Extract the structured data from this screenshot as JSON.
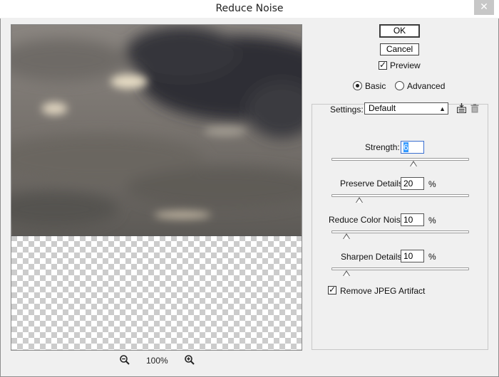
{
  "window": {
    "title": "Reduce Noise",
    "close_glyph": "✕"
  },
  "preview": {
    "zoom_level": "100%",
    "zoom_out_icon": "zoom-out-icon",
    "zoom_in_icon": "zoom-in-icon"
  },
  "buttons": {
    "ok": "OK",
    "cancel": "Cancel"
  },
  "preview_checkbox": {
    "label": "Preview",
    "checked": true
  },
  "mode": {
    "basic": "Basic",
    "advanced": "Advanced",
    "selected": "Basic"
  },
  "settings": {
    "label": "Settings:",
    "value": "Default",
    "save_icon": "save-preset-icon",
    "delete_icon": "trash-icon"
  },
  "sliders": {
    "strength": {
      "label": "Strength:",
      "value": "6",
      "unit": "",
      "min": 0,
      "max": 10
    },
    "preserve_details": {
      "label": "Preserve Details:",
      "value": "20",
      "unit": "%",
      "min": 0,
      "max": 100
    },
    "reduce_color_noise": {
      "label": "Reduce Color Noise:",
      "value": "10",
      "unit": "%",
      "min": 0,
      "max": 100
    },
    "sharpen_details": {
      "label": "Sharpen Details:",
      "value": "10",
      "unit": "%",
      "min": 0,
      "max": 100
    }
  },
  "jpeg_artifact": {
    "label": "Remove JPEG Artifact",
    "checked": true
  },
  "colors": {
    "accent": "#3399ff",
    "background": "#f0f0f0"
  }
}
